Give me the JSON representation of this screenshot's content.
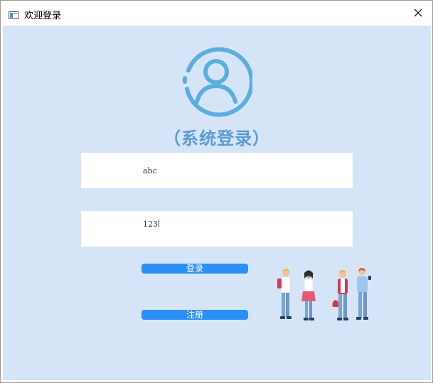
{
  "window": {
    "title": "欢迎登录",
    "close_glyph": "✕"
  },
  "login": {
    "heading": "（系统登录）",
    "username_value": "abc",
    "password_value": "123",
    "login_button": "登录",
    "register_button": "注册"
  },
  "icons": {
    "app": "app-window-icon",
    "avatar": "user-avatar-icon",
    "close": "close-icon",
    "illustration": "people-group-illustration"
  },
  "colors": {
    "background": "#d6e4f7",
    "accent": "#5aaee0",
    "heading": "#5b9bd5",
    "button": "#2b8ff5"
  }
}
